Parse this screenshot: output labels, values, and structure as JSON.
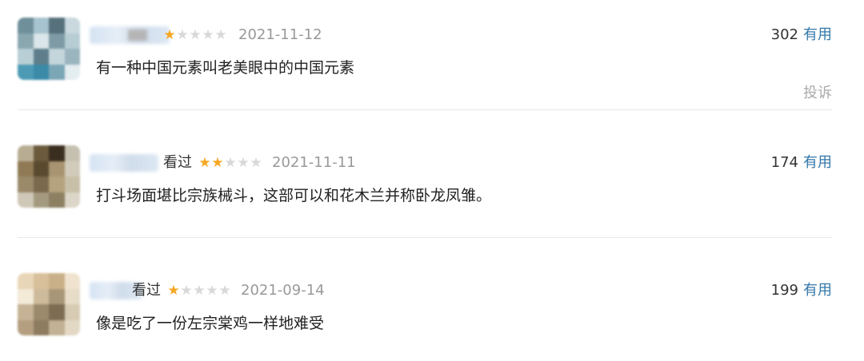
{
  "reviews": [
    {
      "watched_label": "",
      "rating": 1,
      "date": "2021-11-12",
      "votes": "302",
      "useful_label": "有用",
      "comment": "有一种中国元素叫老美眼中的中国元素",
      "report_label": "投诉",
      "avatar_colors": [
        "#6f8f9a",
        "#a7c3cf",
        "#56707c",
        "#c9d9df",
        "#8aa7b0",
        "#dbe6ea",
        "#7d9aa5",
        "#b7cdd4",
        "#b9cfd6",
        "#5e7e8c",
        "#c4d6dc",
        "#9bb5bf",
        "#4d9ab5",
        "#3a8aa8",
        "#7aa6b6",
        "#e4edf0"
      ]
    },
    {
      "watched_label": "看过",
      "rating": 2,
      "date": "2021-11-11",
      "votes": "174",
      "useful_label": "有用",
      "comment": "打斗场面堪比宗族械斗，这部可以和花木兰并称卧龙凤雏。",
      "report_label": "",
      "avatar_colors": [
        "#b8ad93",
        "#6b5a3c",
        "#3a2e20",
        "#c6c0b0",
        "#8f7a55",
        "#5a4a30",
        "#a89470",
        "#d2cbbb",
        "#9a8a6a",
        "#7a6a4c",
        "#b5a27e",
        "#c8bfa8",
        "#cfc8b8",
        "#a49a80",
        "#8c7f62",
        "#dcd6c8"
      ]
    },
    {
      "watched_label": "看过",
      "rating": 1,
      "date": "2021-09-14",
      "votes": "199",
      "useful_label": "有用",
      "comment": "像是吃了一份左宗棠鸡一样地难受",
      "report_label": "",
      "avatar_colors": [
        "#e9d6b8",
        "#d8c09a",
        "#c9b089",
        "#efe3cf",
        "#f3ead8",
        "#cdbb9c",
        "#a89677",
        "#e6dcc8",
        "#c6b396",
        "#9c8a6c",
        "#7d6c52",
        "#d7cbb4",
        "#b49f80",
        "#8e7c60",
        "#c2b193",
        "#e2d8c4"
      ]
    }
  ]
}
